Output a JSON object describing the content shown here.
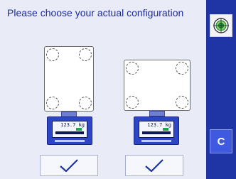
{
  "header": {
    "title": "Please choose your actual configuration"
  },
  "sidebar": {
    "target_icon": "target-icon",
    "c_label": "C"
  },
  "options": [
    {
      "name": "portrait-platform",
      "terminal_readout": "123.7 kg"
    },
    {
      "name": "landscape-platform",
      "terminal_readout": "123.7 kg"
    }
  ],
  "buttons": {
    "confirm_icon": "checkmark-icon"
  },
  "colors": {
    "background": "#e9ebf6",
    "sidebar": "#1f35a5",
    "title": "#1e2c9a",
    "accent_button": "#3f59e0"
  }
}
